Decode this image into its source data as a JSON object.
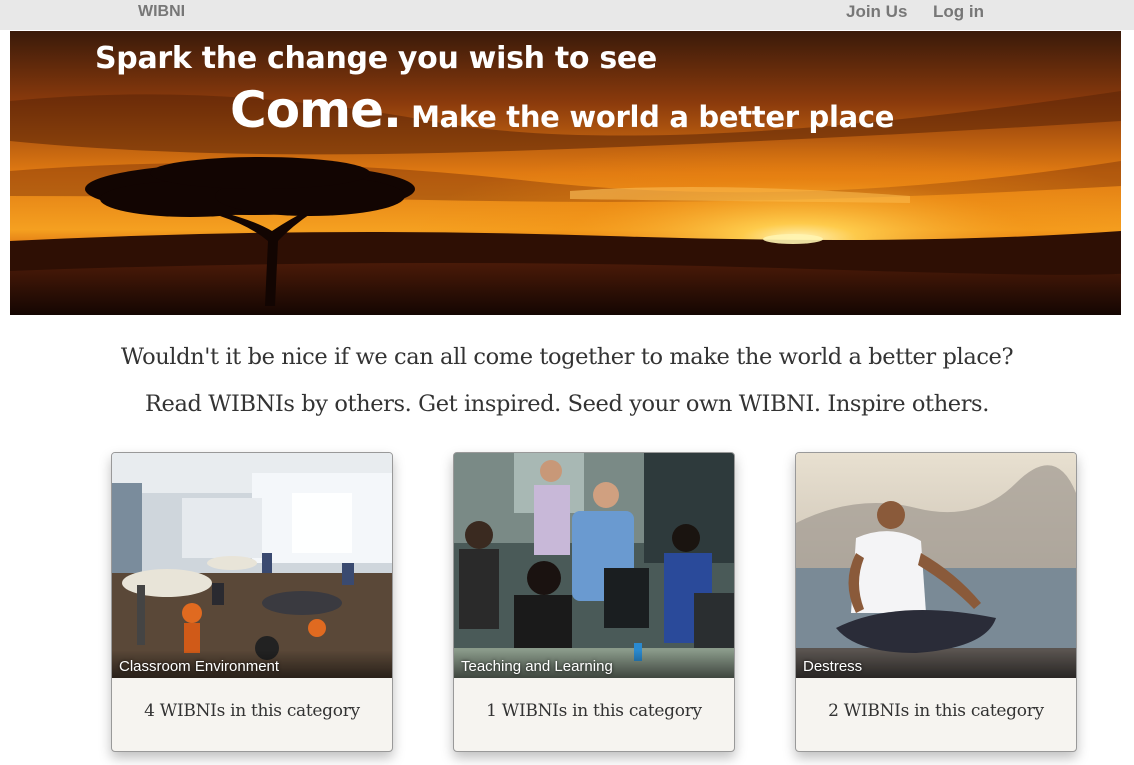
{
  "nav": {
    "brand": "WIBNI",
    "join_label": "Join Us",
    "login_label": "Log in"
  },
  "hero": {
    "line1": "Spark the change you wish to see",
    "come": "Come.",
    "line2": "Make the world a better place"
  },
  "intro": {
    "question": "Wouldn't it be nice if we can all come together to make the world a better place?",
    "tagline": "Read WIBNIs by others. Get inspired. Seed your own WIBNI. Inspire others."
  },
  "categories": [
    {
      "label": "Classroom Environment",
      "count_text": "4 WIBNIs in this category"
    },
    {
      "label": "Teaching and Learning",
      "count_text": "1 WIBNIs in this category"
    },
    {
      "label": "Destress",
      "count_text": "2 WIBNIs in this category"
    }
  ],
  "colors": {
    "topbar_bg": "#e8e8e8",
    "nav_text": "#777777",
    "body_text": "#333333",
    "card_bg": "#f6f4f0"
  }
}
